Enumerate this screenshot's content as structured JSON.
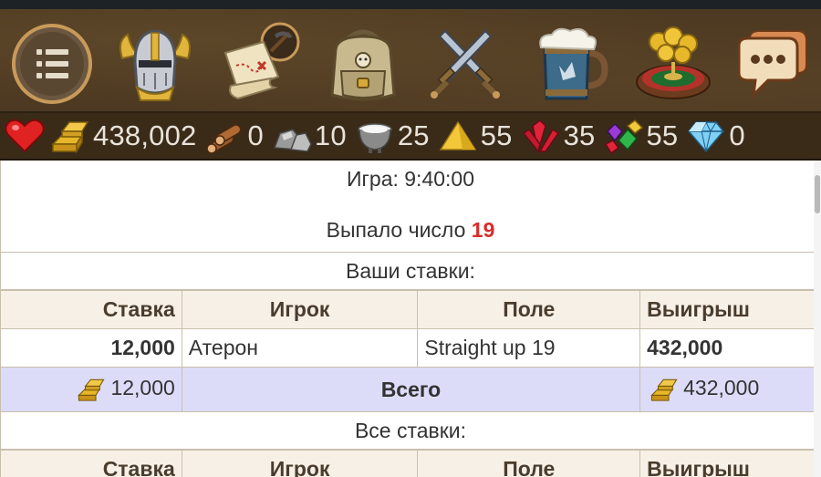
{
  "nav": {
    "icons": [
      {
        "name": "menu-icon"
      },
      {
        "name": "knight-helmet-icon"
      },
      {
        "name": "treasure-map-icon"
      },
      {
        "name": "backpack-icon"
      },
      {
        "name": "crossed-swords-icon"
      },
      {
        "name": "beer-mug-icon"
      },
      {
        "name": "roulette-icon"
      },
      {
        "name": "chat-icon"
      }
    ]
  },
  "resources": {
    "health": {
      "icon": "heart-icon",
      "value": ""
    },
    "gold": {
      "icon": "gold-bars-icon",
      "value": "438,002"
    },
    "wood": {
      "icon": "wood-logs-icon",
      "value": "0"
    },
    "stone": {
      "icon": "stones-icon",
      "value": "10"
    },
    "iron": {
      "icon": "iron-cauldron-icon",
      "value": "25"
    },
    "sand": {
      "icon": "sand-pile-icon",
      "value": "55"
    },
    "crystals": {
      "icon": "red-crystals-icon",
      "value": "35"
    },
    "gems": {
      "icon": "gems-icon",
      "value": "55"
    },
    "diamonds": {
      "icon": "diamond-icon",
      "value": "0"
    }
  },
  "game": {
    "time_label": "Игра: 9:40:00",
    "result_prefix": "Выпало число ",
    "result_number": "19"
  },
  "your_bets": {
    "title": "Ваши ставки:",
    "headers": [
      "Ставка",
      "Игрок",
      "Поле",
      "Выигрыш"
    ],
    "rows": [
      {
        "bet": "12,000",
        "player": "Атерон",
        "field": "Straight up 19",
        "win": "432,000"
      }
    ],
    "total": {
      "bet": "12,000",
      "label": "Всего",
      "win": "432,000"
    }
  },
  "all_bets": {
    "title": "Все ставки:",
    "headers": [
      "Ставка",
      "Игрок",
      "Поле",
      "Выигрыш"
    ]
  },
  "colors": {
    "nav_bg": "#4e3a22",
    "res_bg": "#3a2b19",
    "result_number": "#d92b2b",
    "total_row_bg": "#dcdcf8",
    "header_bg": "#f7f0e6"
  }
}
